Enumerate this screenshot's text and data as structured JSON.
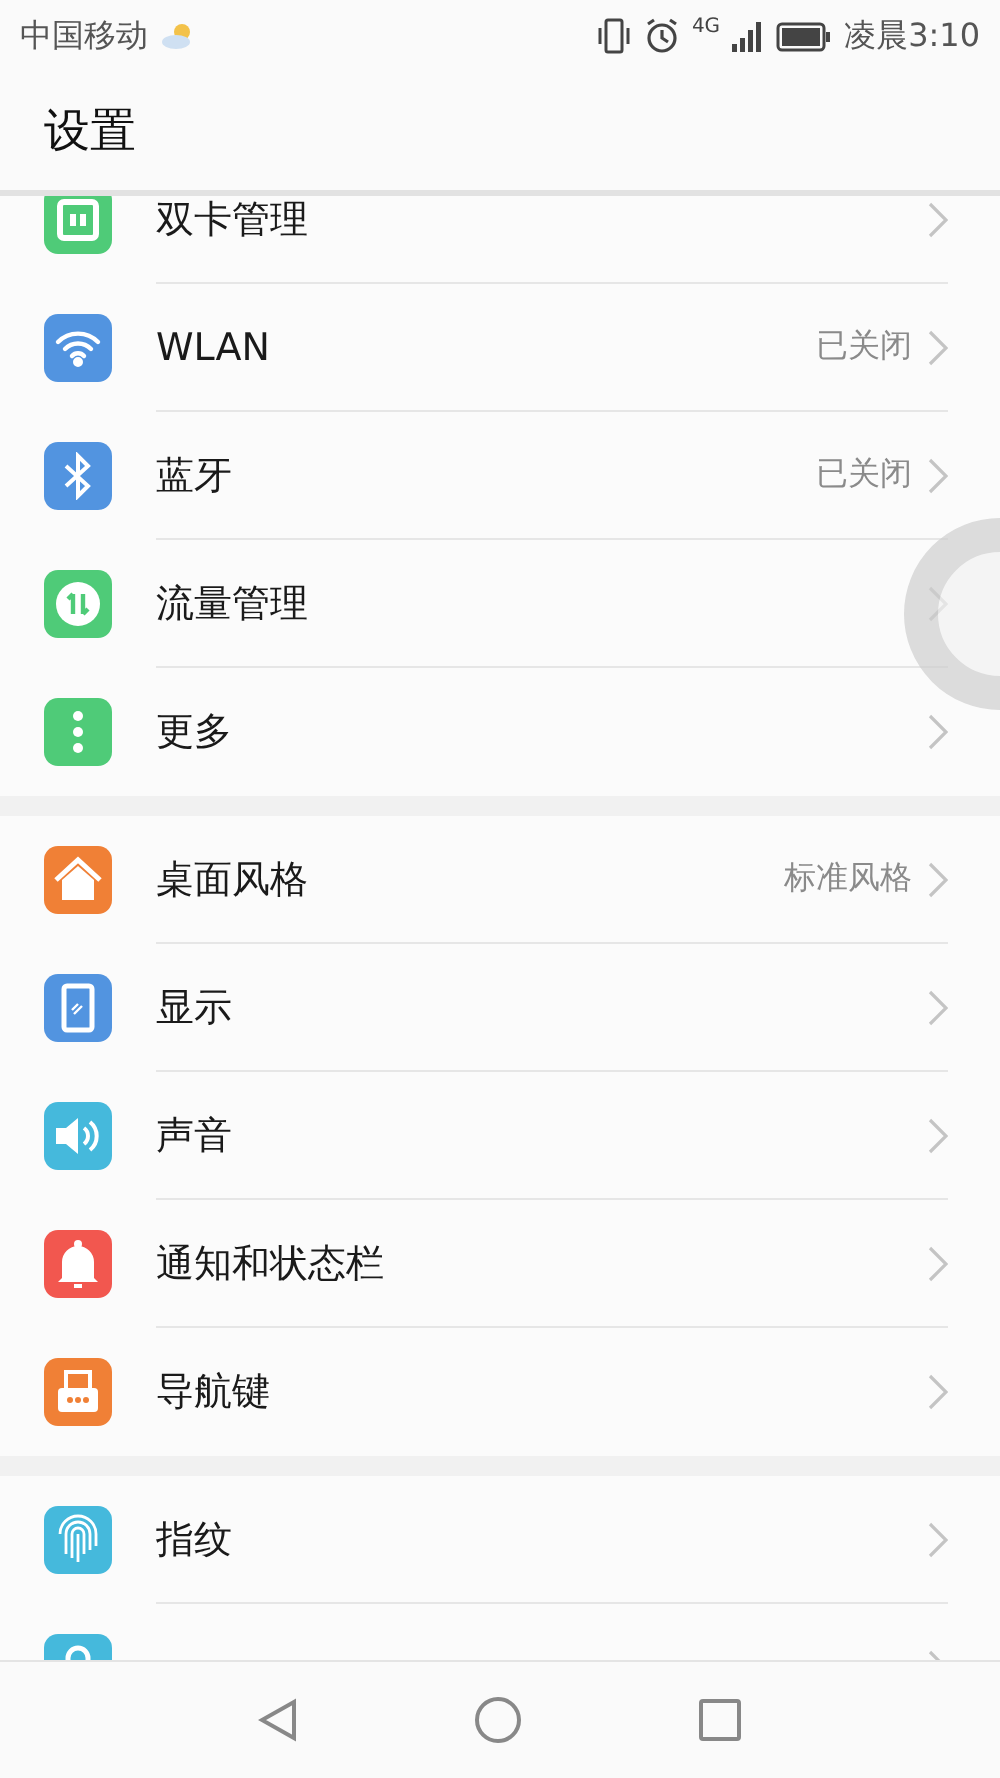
{
  "status_bar": {
    "carrier": "中国移动",
    "network": "4G",
    "time": "凌晨3:10"
  },
  "title": "设置",
  "groups": [
    {
      "items": [
        {
          "label": "双卡管理",
          "kind": "sim",
          "color": "#4fcb78"
        },
        {
          "label": "WLAN",
          "value": "已关闭",
          "kind": "wifi",
          "color": "#5294e0"
        },
        {
          "label": "蓝牙",
          "value": "已关闭",
          "kind": "bluetooth",
          "color": "#5294e0"
        },
        {
          "label": "流量管理",
          "kind": "data",
          "color": "#4fcb78"
        },
        {
          "label": "更多",
          "kind": "more",
          "color": "#4fcb78"
        }
      ]
    },
    {
      "items": [
        {
          "label": "桌面风格",
          "value": "标准风格",
          "kind": "home",
          "color": "#f08036"
        },
        {
          "label": "显示",
          "kind": "display",
          "color": "#5294e0"
        },
        {
          "label": "声音",
          "kind": "sound",
          "color": "#45b9dc"
        },
        {
          "label": "通知和状态栏",
          "kind": "bell",
          "color": "#f2574f"
        },
        {
          "label": "导航键",
          "kind": "nav",
          "color": "#f08036"
        }
      ]
    },
    {
      "items": [
        {
          "label": "指纹",
          "kind": "fingerprint",
          "color": "#45b9dc"
        },
        {
          "kind": "lock",
          "color": "#45b9dc"
        }
      ]
    }
  ]
}
